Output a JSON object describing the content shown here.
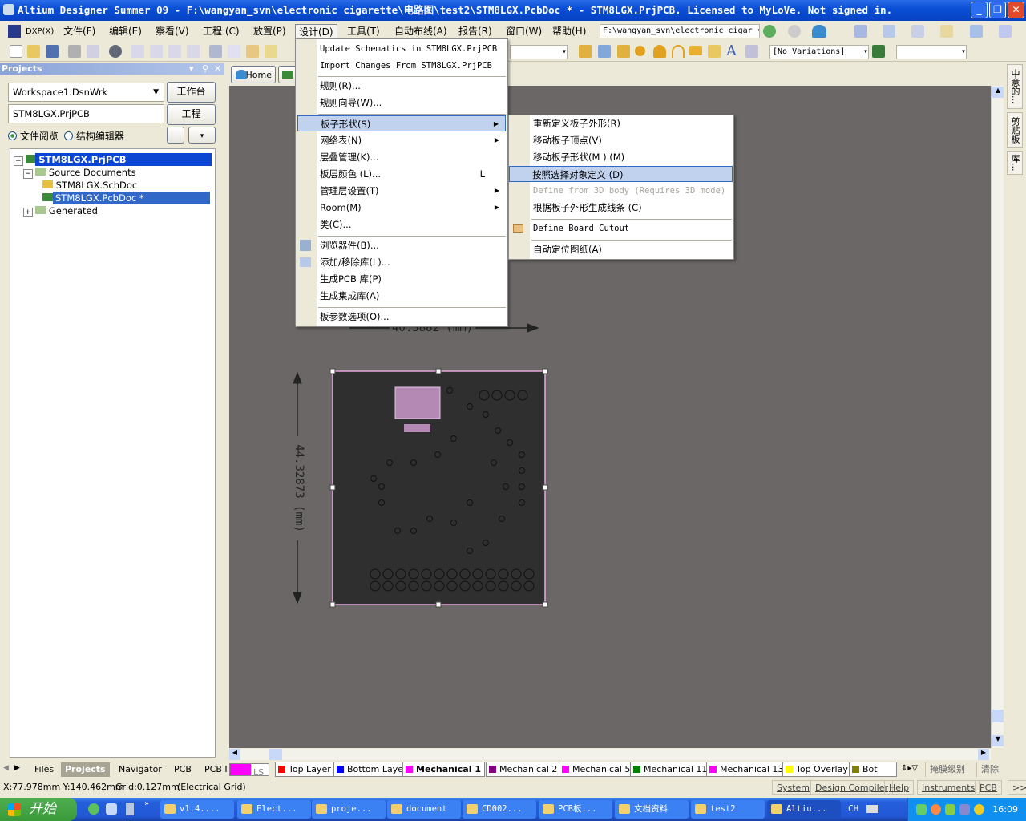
{
  "window": {
    "title": "Altium Designer Summer 09 - F:\\wangyan_svn\\electronic cigarette\\电路图\\test2\\STM8LGX.PcbDoc * - STM8LGX.PrjPCB. Licensed to MyLoVe. Not signed in.",
    "min": "_",
    "max": "❐",
    "close": "✕"
  },
  "menubar": {
    "items": [
      "DXP(X)",
      "文件(F)",
      "编辑(E)",
      "察看(V)",
      "工程 (C)",
      "放置(P)",
      "设计(D)",
      "工具(T)",
      "自动布线(A)",
      "报告(R)",
      "窗口(W)",
      "帮助(H)"
    ],
    "path_combo": "F:\\wangyan_svn\\electronic cigar"
  },
  "toolbar": {
    "variations": "[No Variations]",
    "empty_combo": ""
  },
  "projects_panel": {
    "title": "Projects",
    "workspace": "Workspace1.DsnWrk",
    "workspace_btn": "工作台",
    "project": "STM8LGX.PrjPCB",
    "project_btn": "工程",
    "radio_file": "文件阅览",
    "radio_struct": "结构编辑器",
    "radio_selected": "文件阅览",
    "tree": [
      {
        "label": "STM8LGX.PrjPCB",
        "level": 0,
        "selected": true
      },
      {
        "label": "Source Documents",
        "level": 1
      },
      {
        "label": "STM8LGX.SchDoc",
        "level": 2
      },
      {
        "label": "STM8LGX.PcbDoc *",
        "level": 2,
        "selected": true
      },
      {
        "label": "Generated",
        "level": 1
      }
    ]
  },
  "doc_tabs": [
    "Home"
  ],
  "design_menu": {
    "items": [
      {
        "label": "Update Schematics in STM8LGX.PrjPCB",
        "mono": true
      },
      {
        "label": "Import Changes From STM8LGX.PrjPCB",
        "mono": true
      },
      {
        "label": "规则(R)..."
      },
      {
        "label": "规则向导(W)..."
      },
      {
        "label": "板子形状(S)",
        "submenu": true,
        "highlighted": true
      },
      {
        "label": "网络表(N)",
        "submenu": true
      },
      {
        "label": "层叠管理(K)..."
      },
      {
        "label": "板层颜色 (L)...",
        "shortcut": "L"
      },
      {
        "label": "管理层设置(T)",
        "submenu": true
      },
      {
        "label": "Room(M)",
        "submenu": true
      },
      {
        "label": "类(C)..."
      },
      {
        "label": "浏览器件(B)..."
      },
      {
        "label": "添加/移除库(L)..."
      },
      {
        "label": "生成PCB 库(P)"
      },
      {
        "label": "生成集成库(A)"
      },
      {
        "label": "板参数选项(O)..."
      }
    ]
  },
  "board_shape_submenu": {
    "items": [
      {
        "label": "重新定义板子外形(R)"
      },
      {
        "label": "移动板子顶点(V)"
      },
      {
        "label": "移动板子形状(M ) (M)"
      },
      {
        "label": "按照选择对象定义 (D)",
        "highlighted": true
      },
      {
        "label": "Define from 3D body (Requires 3D mode)",
        "disabled": true
      },
      {
        "label": "根据板子外形生成线条 (C)"
      },
      {
        "label": "Define Board Cutout"
      },
      {
        "label": "自动定位图纸(A)"
      }
    ]
  },
  "canvas": {
    "dim_width": "40.3882 (mm)",
    "dim_height": "44.32873 (mm)",
    "board_color": "#2f2f2f",
    "outline_color": "#e8a8e0",
    "background": "#6b6767"
  },
  "right_tabs": [
    "中意的...",
    "剪贴板",
    "库..."
  ],
  "panel_tabs": [
    "Files",
    "Projects",
    "Navigator",
    "PCB",
    "PCB I"
  ],
  "panel_tab_active": "Projects",
  "layer_tabs": [
    {
      "label": "LS",
      "color": "#ff00ff"
    },
    {
      "label": "Top Layer",
      "color": "#ff0000"
    },
    {
      "label": "Bottom Layer",
      "color": "#0000ff"
    },
    {
      "label": "Mechanical 1",
      "color": "#ff00ff",
      "active": true
    },
    {
      "label": "Mechanical 2",
      "color": "#800080"
    },
    {
      "label": "Mechanical 5",
      "color": "#ff00ff"
    },
    {
      "label": "Mechanical 11",
      "color": "#008000"
    },
    {
      "label": "Mechanical 13",
      "color": "#ff00ff"
    },
    {
      "label": "Top Overlay",
      "color": "#ffff00"
    },
    {
      "label": "Bot",
      "color": "#808000"
    }
  ],
  "layer_buttons": {
    "mask": "掩膜级别",
    "clear": "清除"
  },
  "statusbar": {
    "coords": "X:77.978mm Y:140.462mm",
    "grid": "Grid:0.127mm",
    "grid_type": "(Electrical Grid)",
    "buttons": [
      "System",
      "Design Compiler",
      "Help",
      "Instruments",
      "PCB",
      ">>"
    ]
  },
  "taskbar": {
    "start": "开始",
    "tasks": [
      "v1.4....",
      "Elect...",
      "proje...",
      "document",
      "CD002...",
      "PCB板...",
      "文档资料",
      "test2",
      "Altiu..."
    ],
    "active_task": "Altiu...",
    "lang": "CH",
    "time": "16:09"
  }
}
